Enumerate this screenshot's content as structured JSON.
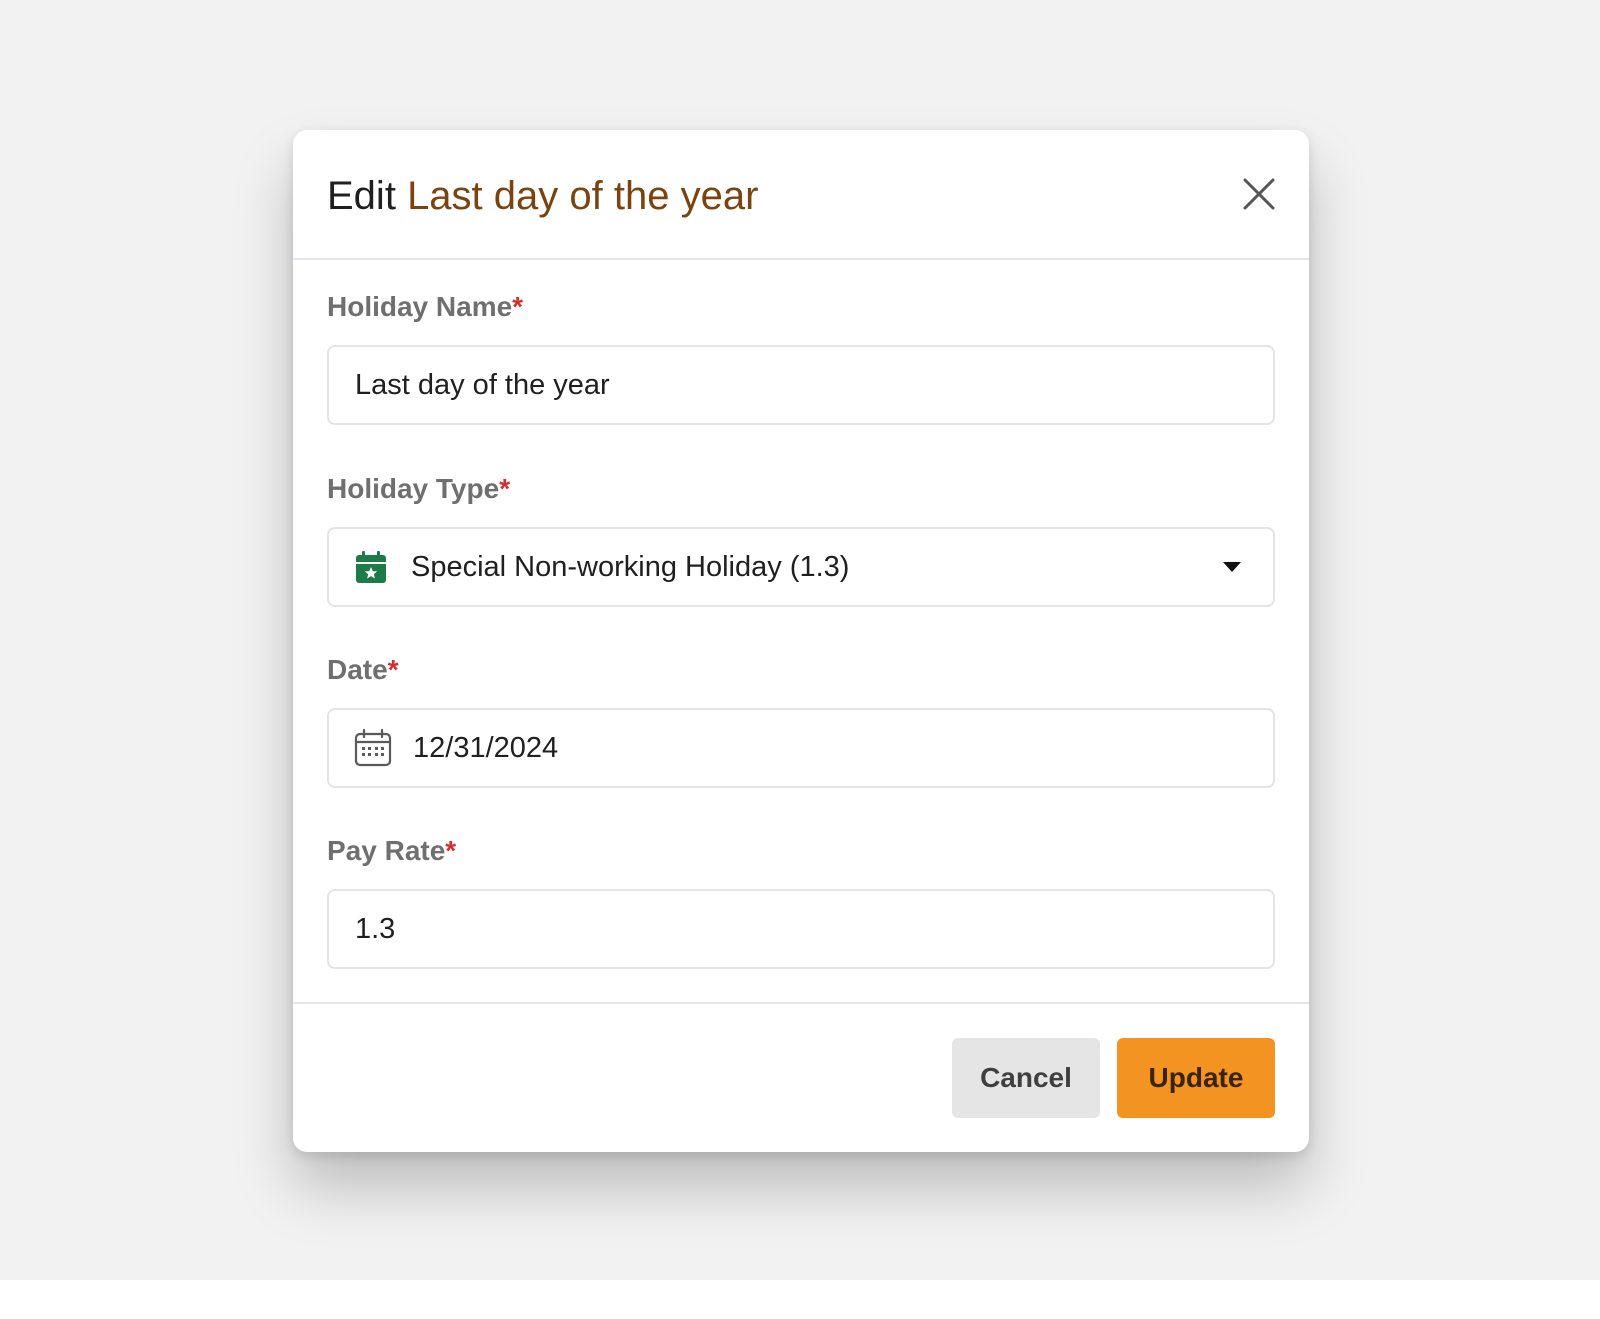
{
  "modal": {
    "title_prefix": "Edit",
    "title_name": "Last day of the year",
    "close_icon": "close-icon"
  },
  "fields": {
    "holiday_name": {
      "label": "Holiday Name",
      "required_mark": "*",
      "value": "Last day of the year"
    },
    "holiday_type": {
      "label": "Holiday Type",
      "required_mark": "*",
      "value": "Special Non-working Holiday (1.3)",
      "icon": "calendar-star-icon",
      "icon_color": "#1f7a4a",
      "dropdown_icon": "caret-down-icon"
    },
    "date": {
      "label": "Date",
      "required_mark": "*",
      "value": "12/31/2024",
      "icon": "calendar-icon"
    },
    "pay_rate": {
      "label": "Pay Rate",
      "required_mark": "*",
      "value": "1.3"
    }
  },
  "footer": {
    "cancel_label": "Cancel",
    "update_label": "Update"
  },
  "colors": {
    "accent": "#f39322",
    "title_name": "#7a4310",
    "required": "#d32f2f"
  }
}
